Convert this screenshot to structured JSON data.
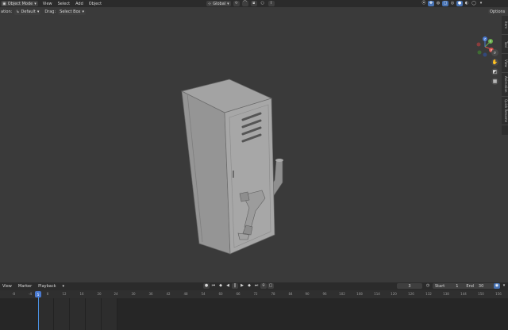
{
  "header": {
    "mode_label": "Object Mode",
    "menus": [
      "View",
      "Select",
      "Add",
      "Object"
    ],
    "transform_orientation": "Global"
  },
  "toolbar": {
    "orientation_label": "ation:",
    "orientation_value": "Default",
    "drag_label": "Drag:",
    "drag_value": "Select Box",
    "options_label": "Options"
  },
  "sidebar_tabs": [
    "Item",
    "Tool",
    "View",
    "Animation",
    "Quick Rename"
  ],
  "gizmo": {
    "x": "X",
    "y": "Y",
    "z": "Z"
  },
  "timeline": {
    "menus": [
      "View",
      "Marker",
      "Playback"
    ],
    "current_frame": "3",
    "start_label": "Start",
    "start_value": "1",
    "end_label": "End",
    "end_value": "30",
    "playhead_label": "5",
    "ruler": [
      "-8",
      "-4",
      "8",
      "12",
      "16",
      "20",
      "24",
      "30",
      "36",
      "42",
      "48",
      "54",
      "60",
      "66",
      "72",
      "78",
      "84",
      "90",
      "96",
      "102",
      "108",
      "114",
      "120",
      "126",
      "132",
      "138",
      "144",
      "150",
      "156",
      "162"
    ]
  },
  "colors": {
    "accent": "#4772b3",
    "playhead": "#4a90e2",
    "viewport": "#3a3a3a"
  }
}
